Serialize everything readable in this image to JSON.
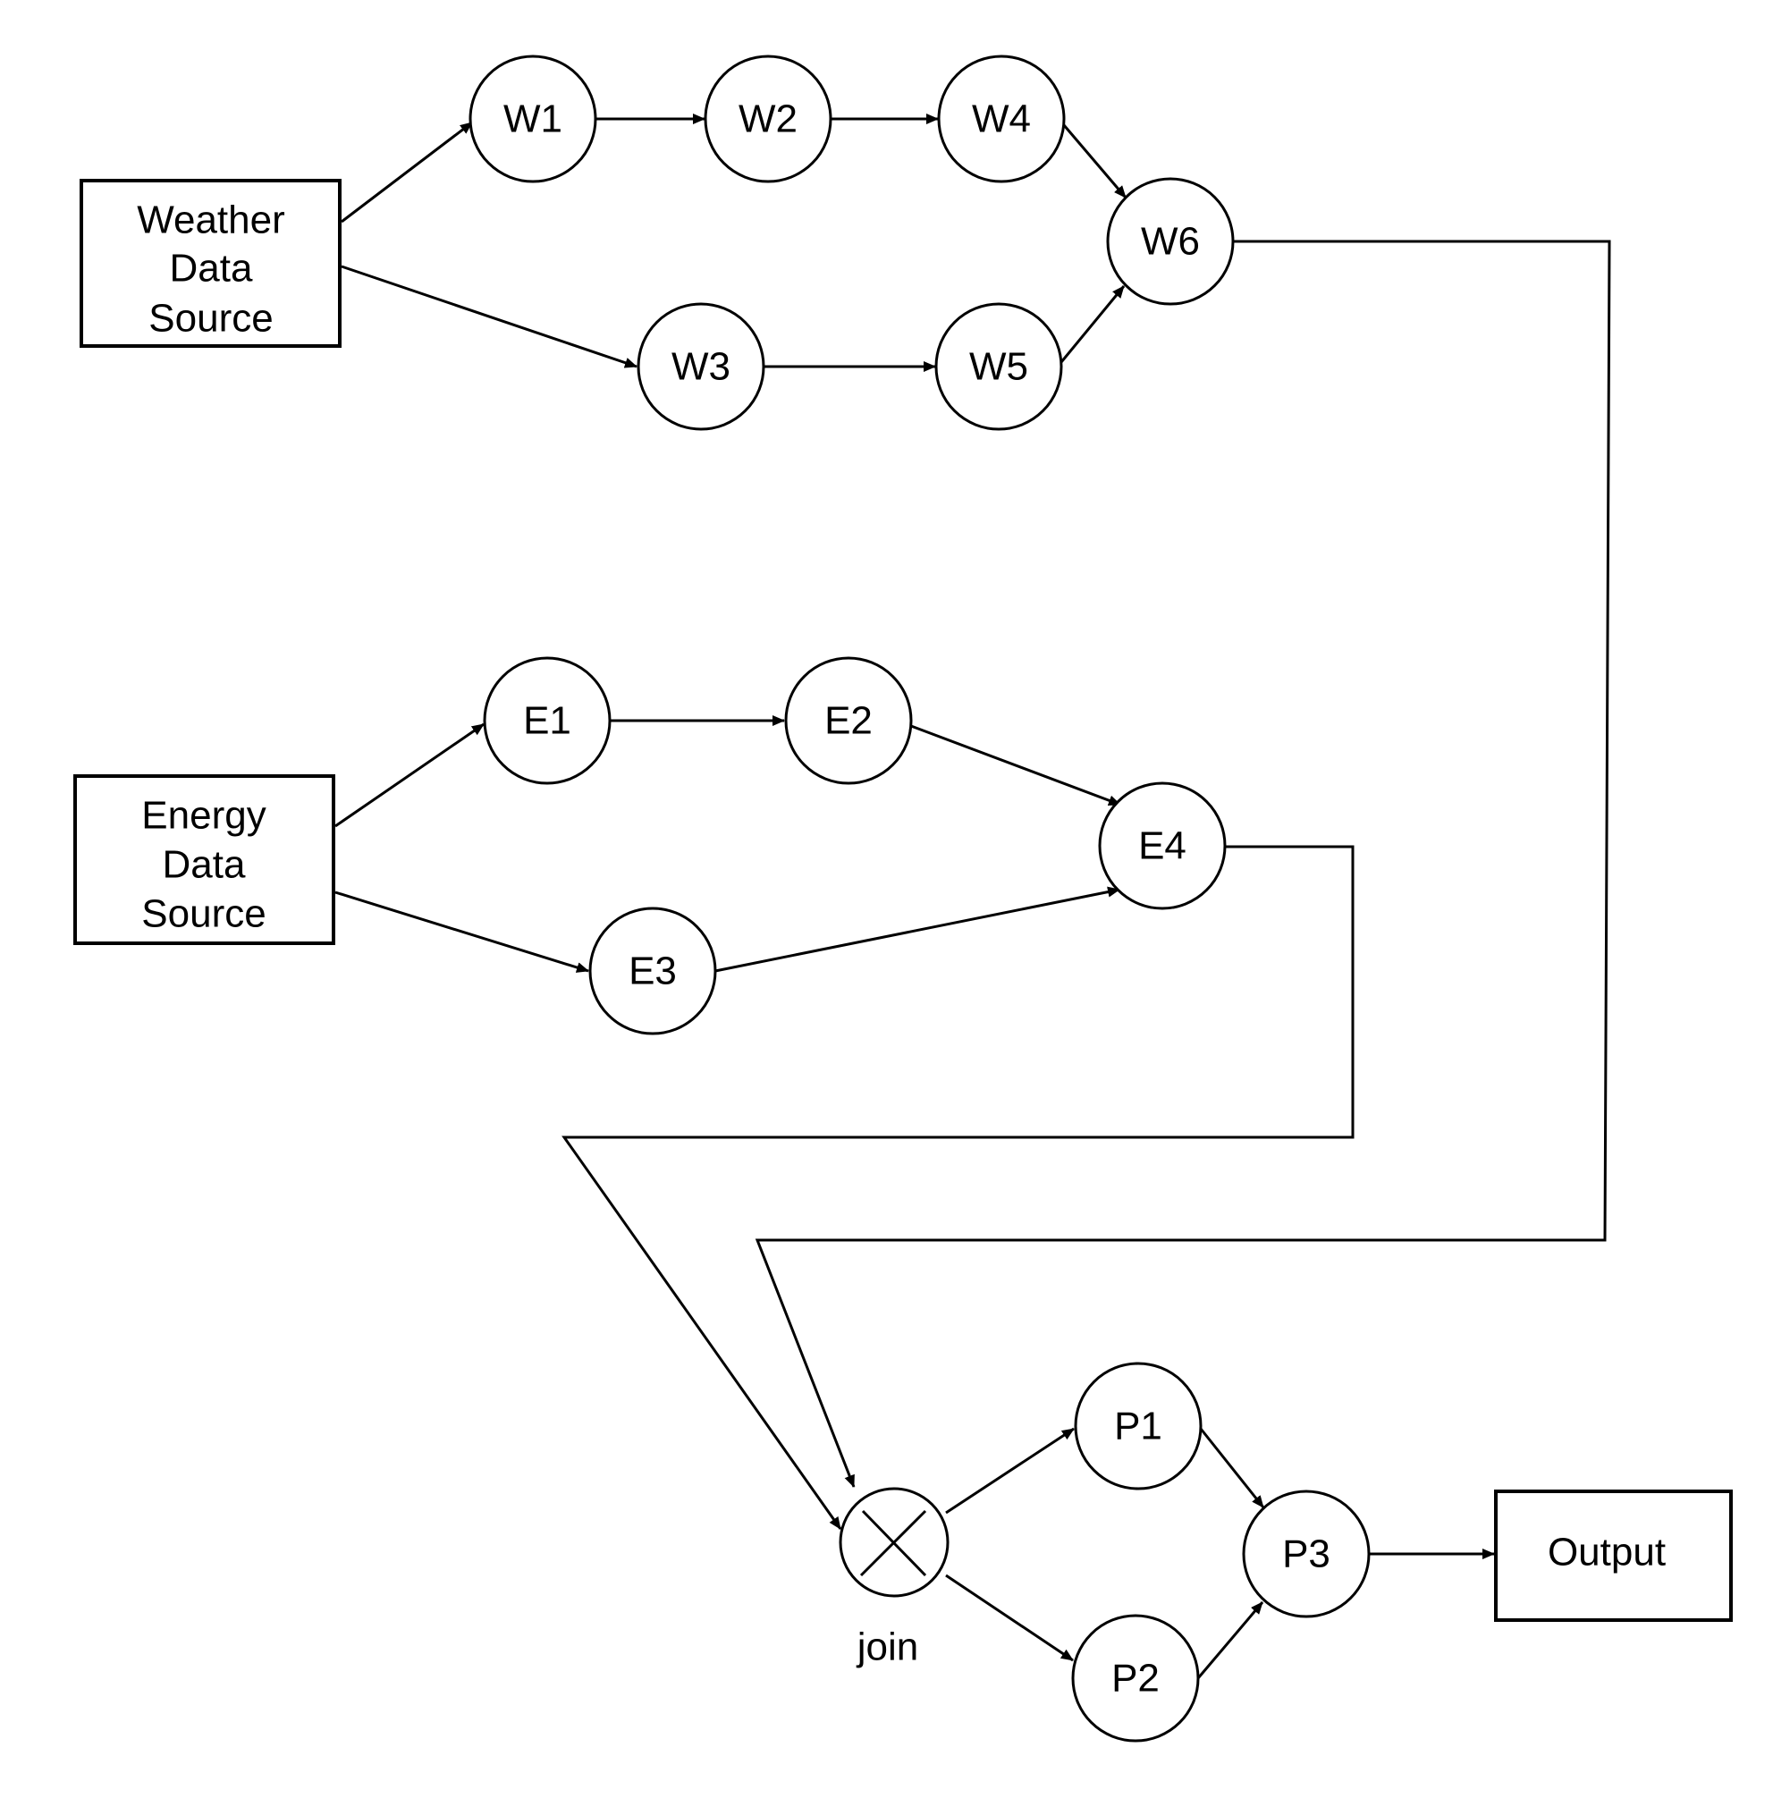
{
  "diagram": {
    "sources": [
      {
        "id": "weather",
        "lines": [
          "Weather",
          "Data",
          "Source"
        ]
      },
      {
        "id": "energy",
        "lines": [
          "Energy",
          "Data",
          "Source"
        ]
      }
    ],
    "nodes": [
      {
        "id": "W1",
        "label": "W1"
      },
      {
        "id": "W2",
        "label": "W2"
      },
      {
        "id": "W3",
        "label": "W3"
      },
      {
        "id": "W4",
        "label": "W4"
      },
      {
        "id": "W5",
        "label": "W5"
      },
      {
        "id": "W6",
        "label": "W6"
      },
      {
        "id": "E1",
        "label": "E1"
      },
      {
        "id": "E2",
        "label": "E2"
      },
      {
        "id": "E3",
        "label": "E3"
      },
      {
        "id": "E4",
        "label": "E4"
      },
      {
        "id": "P1",
        "label": "P1"
      },
      {
        "id": "P2",
        "label": "P2"
      },
      {
        "id": "P3",
        "label": "P3"
      }
    ],
    "join": {
      "label": "join"
    },
    "output": {
      "label": "Output"
    },
    "edges": [
      [
        "weather",
        "W1"
      ],
      [
        "weather",
        "W3"
      ],
      [
        "W1",
        "W2"
      ],
      [
        "W2",
        "W4"
      ],
      [
        "W4",
        "W6"
      ],
      [
        "W3",
        "W5"
      ],
      [
        "W5",
        "W6"
      ],
      [
        "W6",
        "join"
      ],
      [
        "energy",
        "E1"
      ],
      [
        "energy",
        "E3"
      ],
      [
        "E1",
        "E2"
      ],
      [
        "E2",
        "E4"
      ],
      [
        "E3",
        "E4"
      ],
      [
        "E4",
        "join"
      ],
      [
        "join",
        "P1"
      ],
      [
        "join",
        "P2"
      ],
      [
        "P1",
        "P3"
      ],
      [
        "P2",
        "P3"
      ],
      [
        "P3",
        "output"
      ]
    ]
  }
}
